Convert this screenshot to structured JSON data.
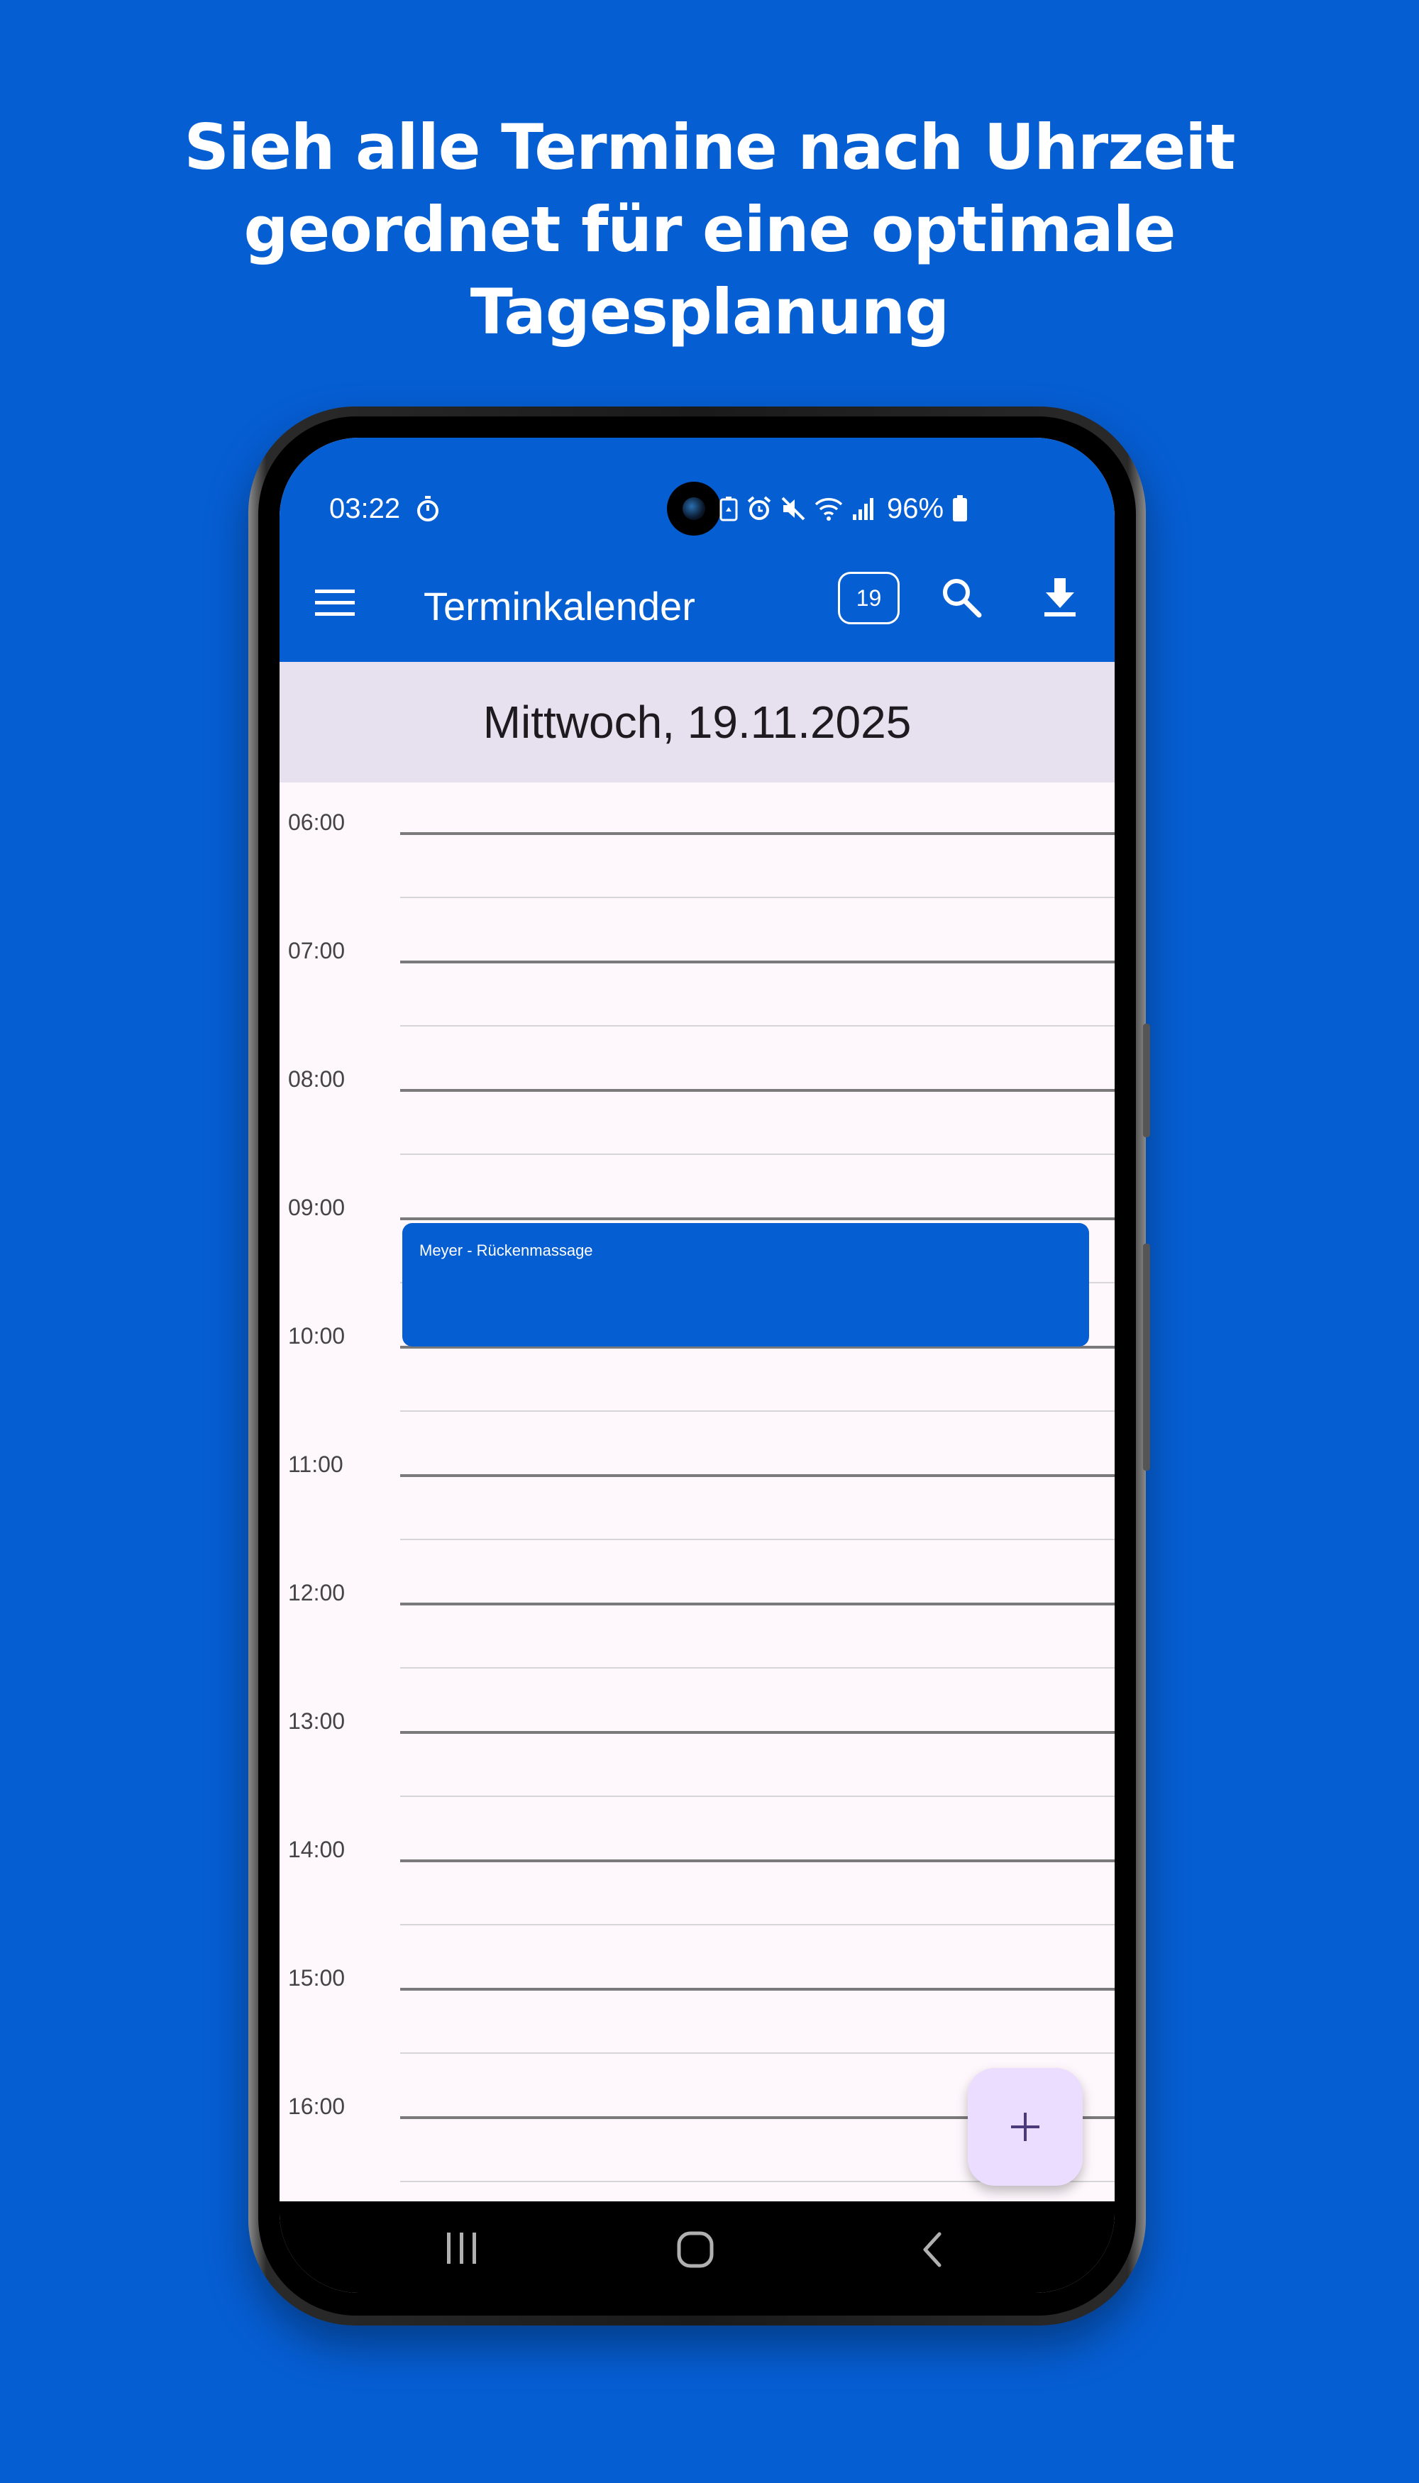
{
  "headline": {
    "line1": "Sieh alle Termine nach Uhrzeit",
    "line2": "geordnet für eine optimale",
    "line3": "Tagesplanung"
  },
  "status_bar": {
    "time": "03:22",
    "battery": "96%",
    "icons": [
      "stopwatch-icon",
      "battery-saver-icon",
      "alarm-icon",
      "mute-icon",
      "wifi-icon",
      "signal-icon",
      "battery-icon"
    ]
  },
  "app_bar": {
    "title": "Terminkalender",
    "today_chip": "19",
    "icons": [
      "menu-icon",
      "calendar-today-icon",
      "search-icon",
      "download-icon"
    ]
  },
  "day_header": "Mittwoch, 19.11.2025",
  "timeline": {
    "hours": [
      "06:00",
      "07:00",
      "08:00",
      "09:00",
      "10:00",
      "11:00",
      "12:00",
      "13:00",
      "14:00",
      "15:00",
      "16:00"
    ]
  },
  "events": [
    {
      "title": "Meyer - Rückenmassage",
      "start": "09:00",
      "end": "10:00",
      "color": "#065ed3"
    }
  ],
  "fab": {
    "icon": "plus-icon",
    "color": "#eaddff"
  },
  "nav_bar": {
    "icons": [
      "recents-icon",
      "home-icon",
      "back-icon"
    ]
  },
  "colors": {
    "primary": "#065ed3",
    "day_header_bg": "#e7e1ef",
    "surface": "#fef7fc"
  }
}
